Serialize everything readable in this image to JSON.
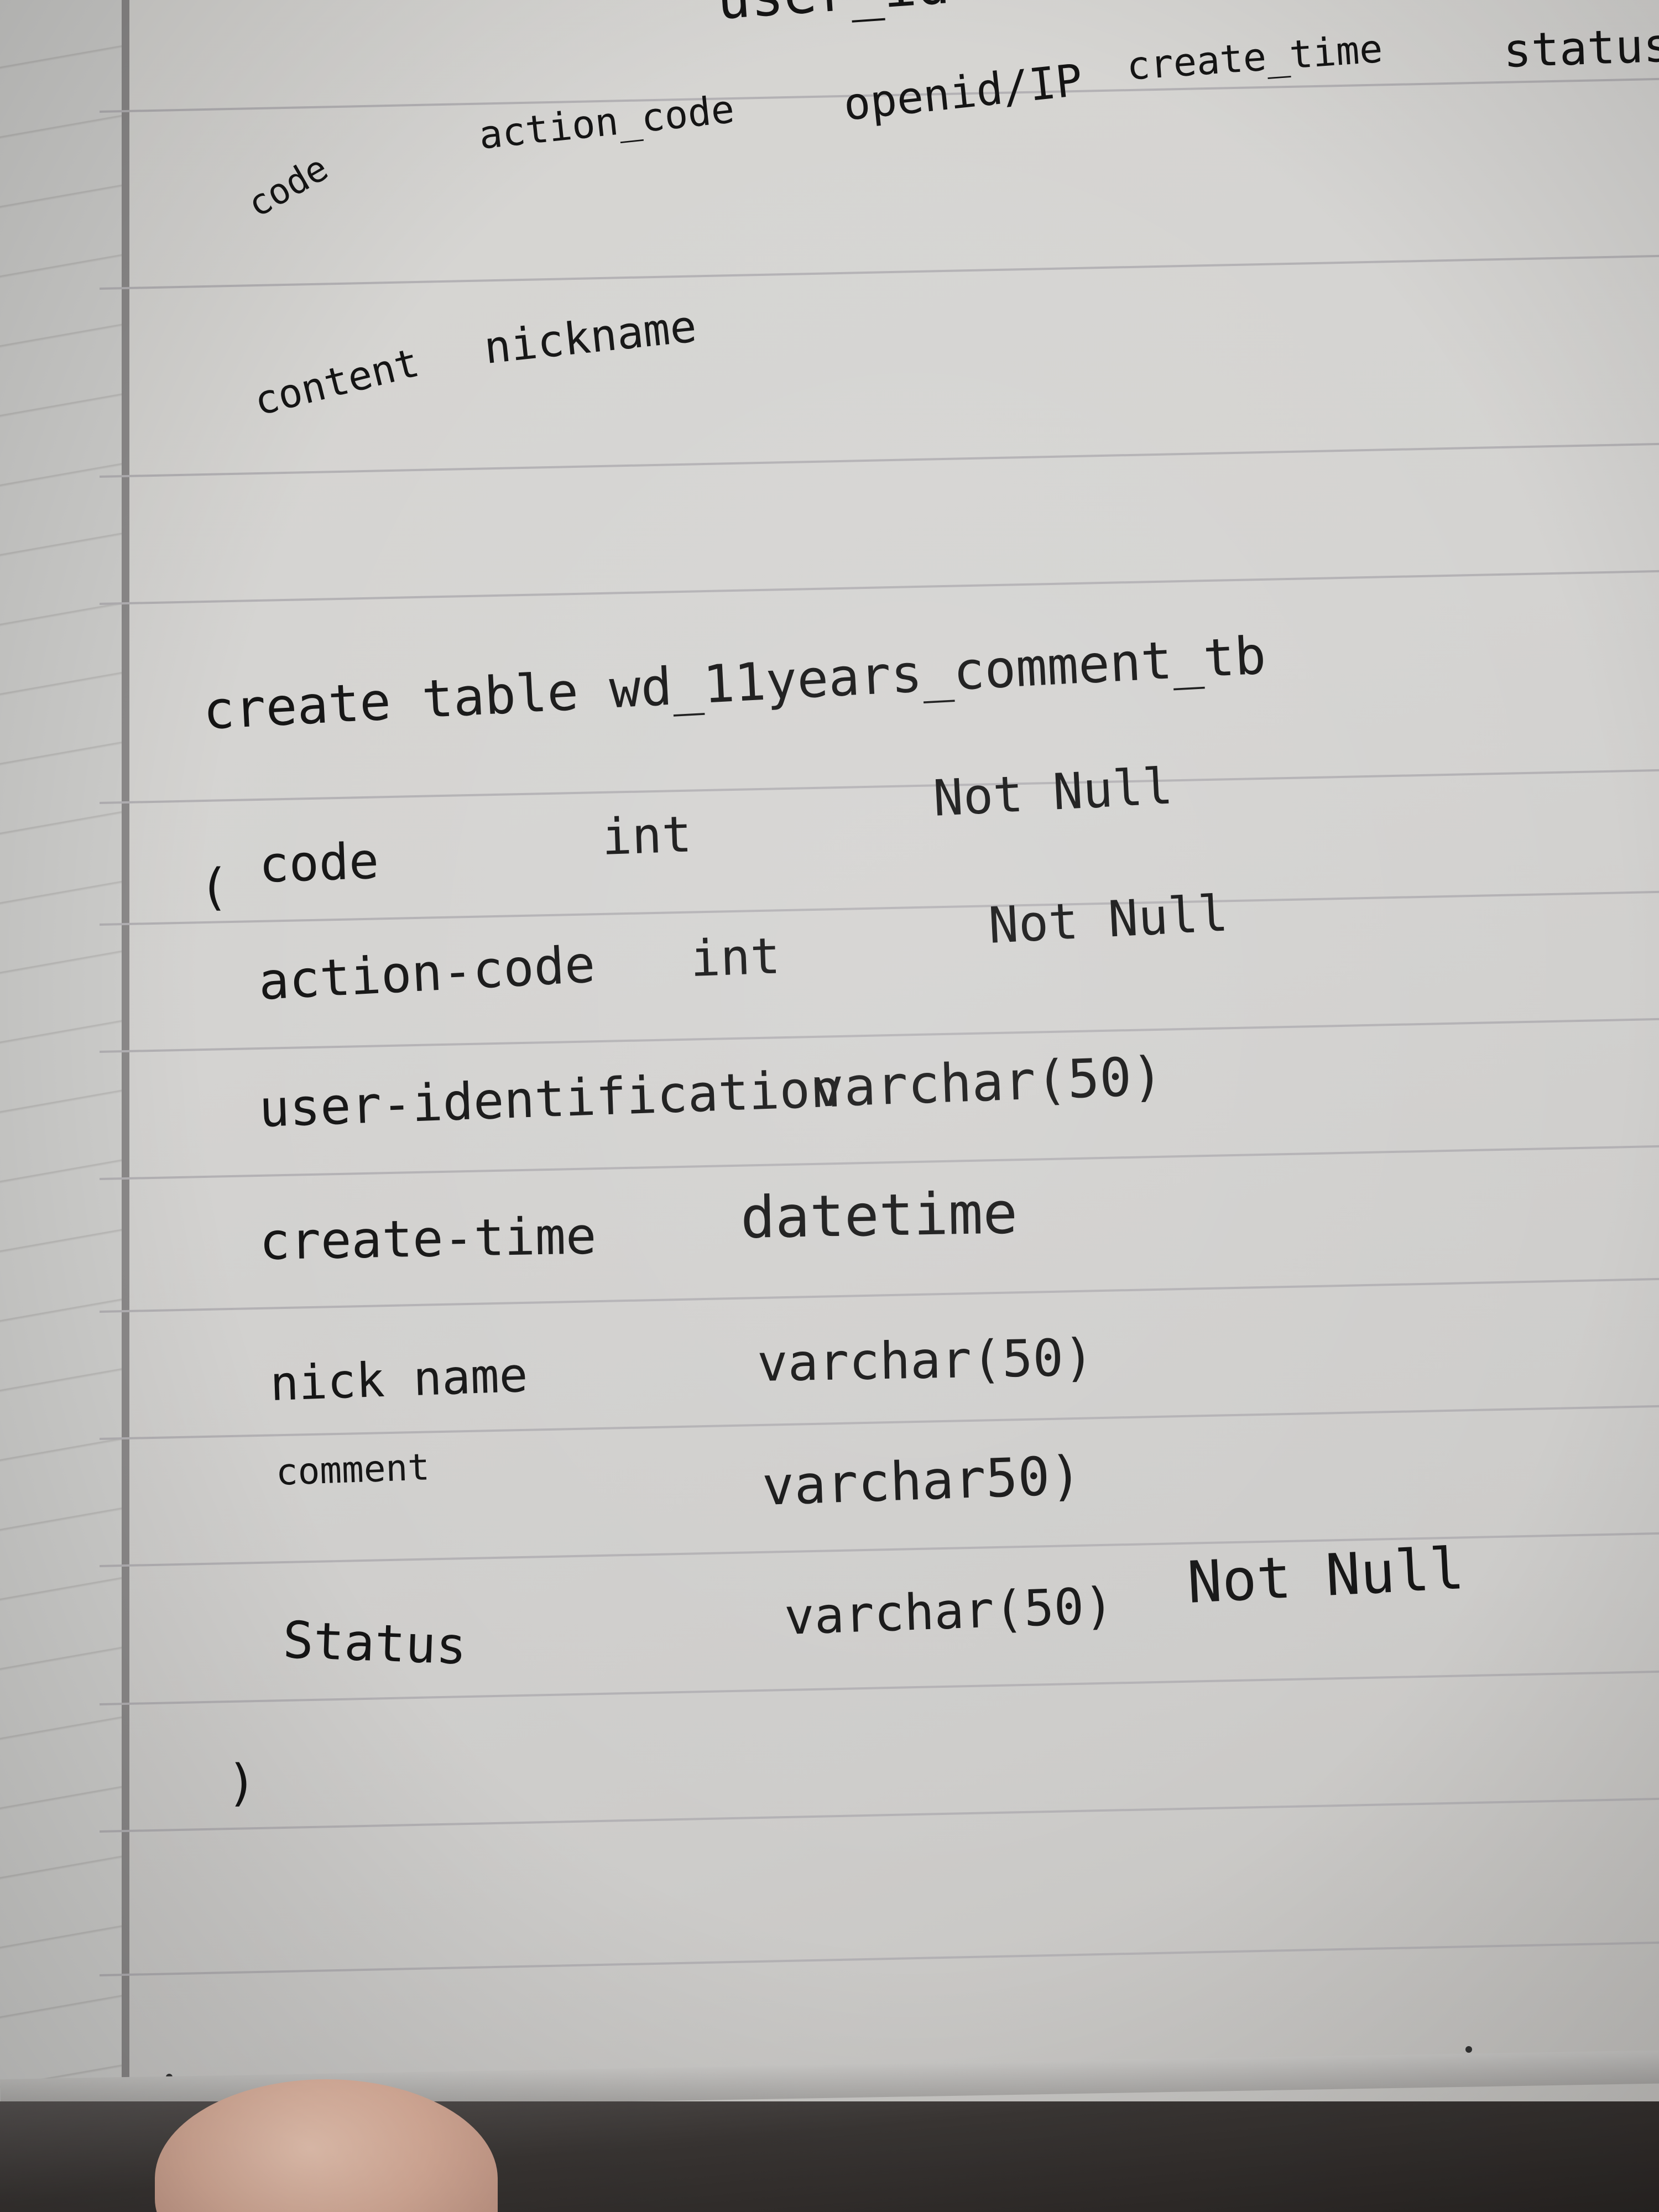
{
  "notebook": {
    "top_fragments": {
      "cut_off": "user_id",
      "col_code": "code",
      "col_action_code": "action_code",
      "col_openid": "openid/IP",
      "col_create_time": "create_time",
      "col_status": "status",
      "col_content": "content",
      "col_nickname": "nickname"
    },
    "sql": {
      "header": "create table wd_11years_comment_tb",
      "open_paren": "(",
      "rows": [
        {
          "name": "code",
          "type": "int",
          "constraint": "Not Null"
        },
        {
          "name": "action-code",
          "type": "int",
          "constraint": "Not Null"
        },
        {
          "name": "user-identification",
          "type": "varchar(50)",
          "constraint": ""
        },
        {
          "name": "create-time",
          "type": "datetime",
          "constraint": ""
        },
        {
          "name": "nick name",
          "type": "varchar(50)",
          "constraint": ""
        },
        {
          "name": "comment",
          "type": "varchar50)",
          "constraint": ""
        },
        {
          "name": "Status",
          "type": "varchar(50)",
          "constraint": "Not Null"
        }
      ],
      "close_paren": ")"
    }
  }
}
